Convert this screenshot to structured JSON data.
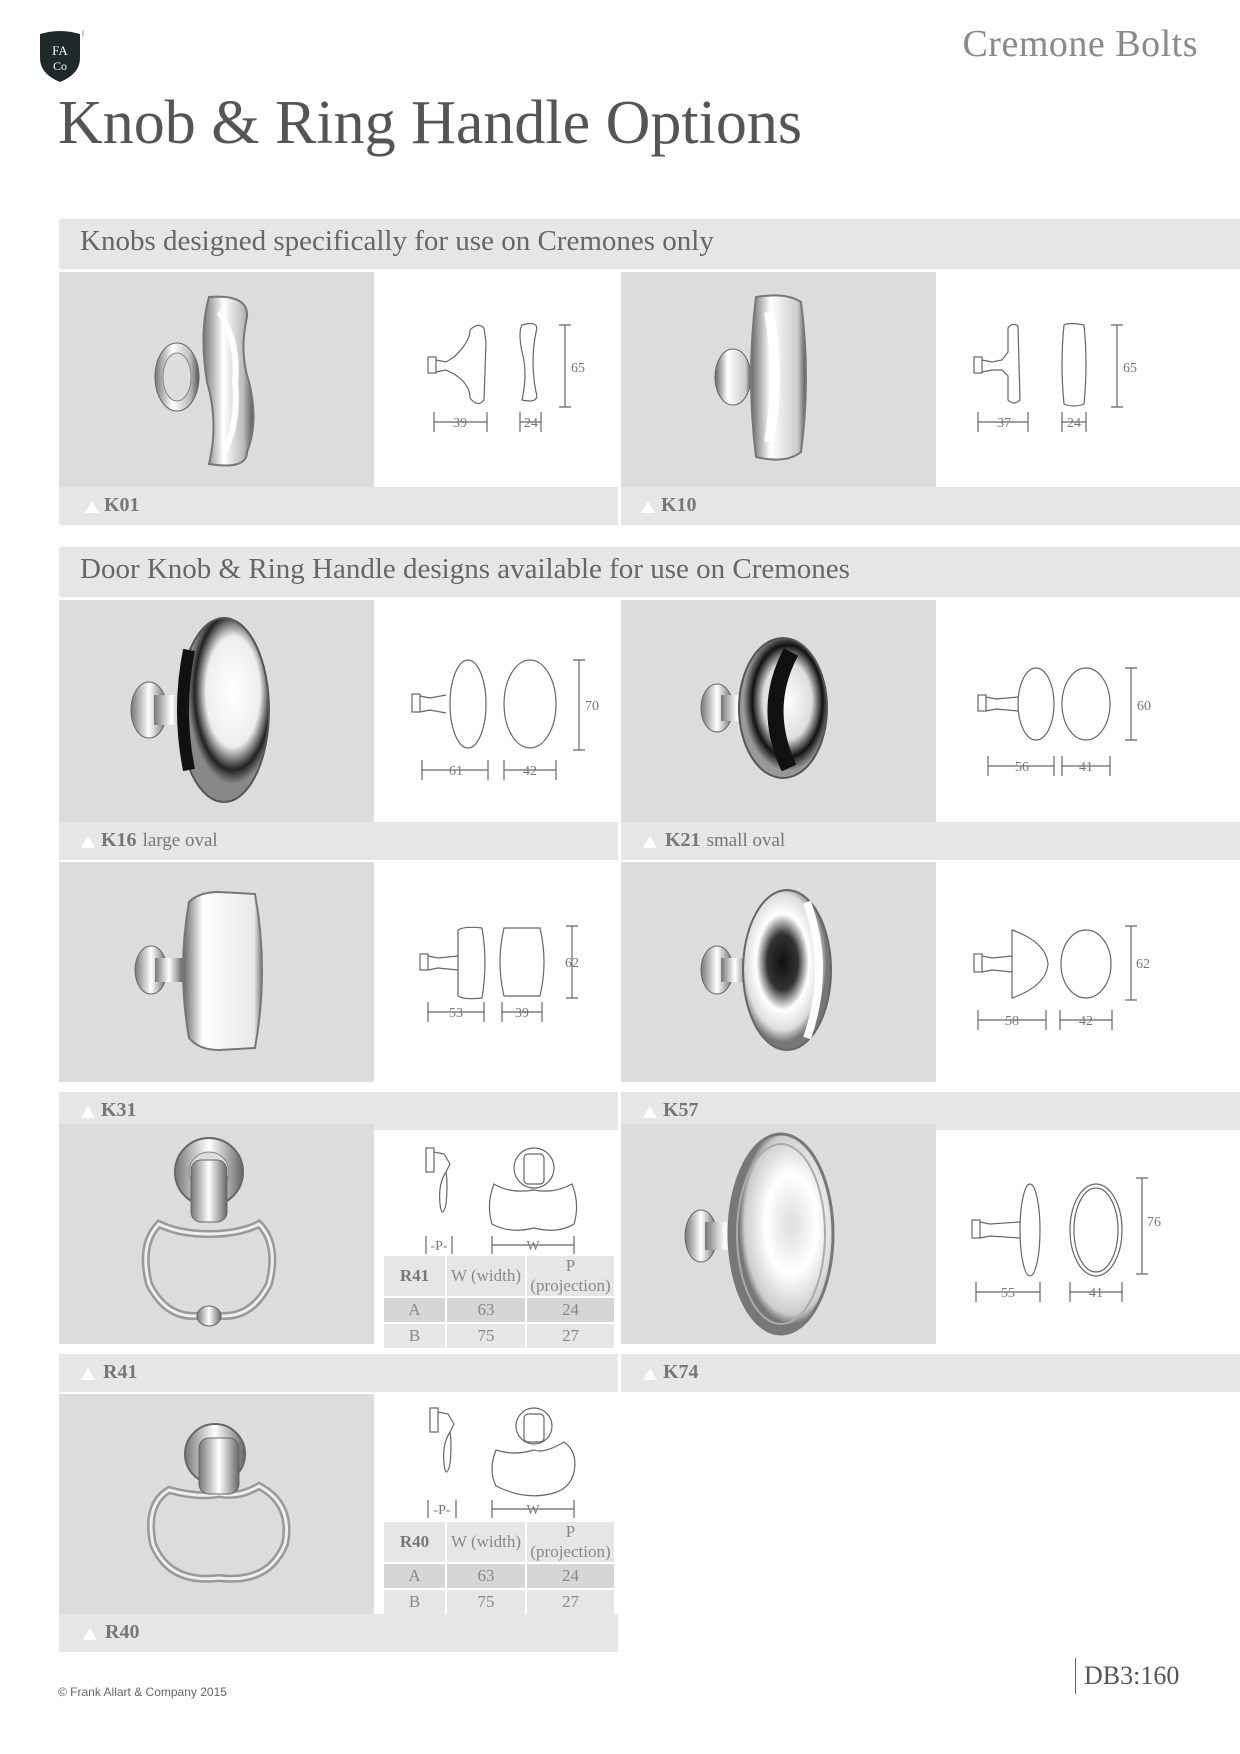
{
  "header": {
    "logo_text_top": "FA",
    "logo_text_bottom": "Co",
    "logo_registered": "®",
    "section_label": "Cremone Bolts",
    "page_title": "Knob & Ring Handle Options"
  },
  "sections": [
    {
      "title": "Knobs designed specifically for use on Cremones only"
    },
    {
      "title": "Door Knob & Ring Handle designs available for use on Cremones"
    }
  ],
  "products": [
    {
      "code": "K01",
      "desc": "",
      "length": "39",
      "width": "24",
      "height": "65"
    },
    {
      "code": "K10",
      "desc": "",
      "length": "37",
      "width": "24",
      "height": "65"
    },
    {
      "code": "K16",
      "desc": "large oval",
      "length": "61",
      "width": "42",
      "height": "70"
    },
    {
      "code": "K21",
      "desc": "small oval",
      "length": "56",
      "width": "41",
      "height": "60"
    },
    {
      "code": "K31",
      "desc": "",
      "length": "53",
      "width": "39",
      "height": "62"
    },
    {
      "code": "K57",
      "desc": "",
      "length": "58",
      "width": "42",
      "height": "62"
    },
    {
      "code": "R41",
      "desc": "",
      "p_label": "-P-",
      "w_label": "W",
      "table": {
        "headers": [
          "R41",
          "W (width)",
          "P (projection)"
        ],
        "rows": [
          [
            "A",
            "63",
            "24"
          ],
          [
            "B",
            "75",
            "27"
          ]
        ]
      }
    },
    {
      "code": "K74",
      "desc": "",
      "length": "55",
      "width": "41",
      "height": "76"
    },
    {
      "code": "R40",
      "desc": "",
      "p_label": "-P-",
      "w_label": "W",
      "table": {
        "headers": [
          "R40",
          "W (width)",
          "P (projection)"
        ],
        "rows": [
          [
            "A",
            "63",
            "24"
          ],
          [
            "B",
            "75",
            "27"
          ]
        ]
      }
    }
  ],
  "footer": {
    "copyright": "© Frank Allart & Company 2015",
    "page_number": "DB3:160"
  }
}
